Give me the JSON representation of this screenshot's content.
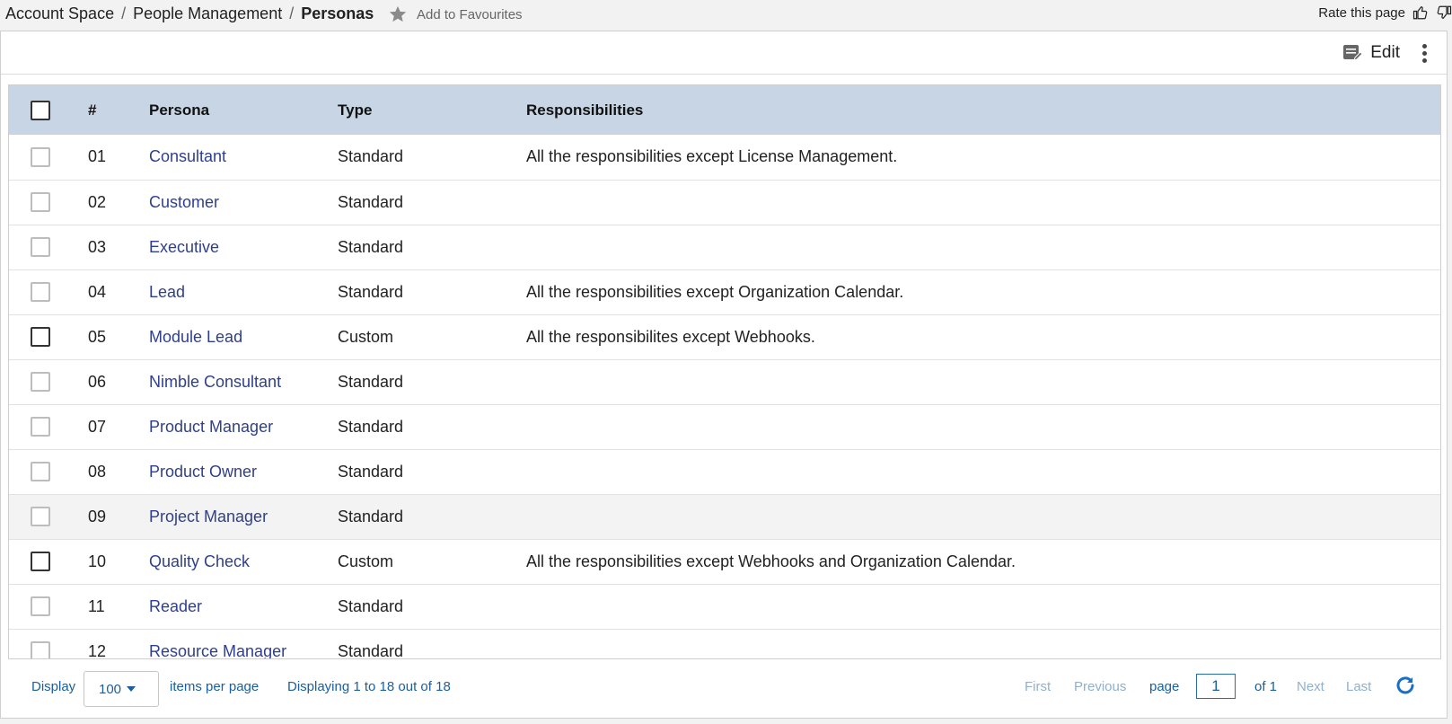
{
  "breadcrumb": {
    "items": [
      "Account Space",
      "People Management"
    ],
    "current": "Personas",
    "separator": "/"
  },
  "favourites_label": "Add to Favourites",
  "rate_label": "Rate this page",
  "toolbar": {
    "edit_label": "Edit"
  },
  "table": {
    "headers": {
      "num": "#",
      "persona": "Persona",
      "type": "Type",
      "responsibilities": "Responsibilities"
    },
    "rows": [
      {
        "num": "01",
        "persona": "Consultant",
        "type": "Standard",
        "responsibilities": "All the responsibilities except License Management."
      },
      {
        "num": "02",
        "persona": "Customer",
        "type": "Standard",
        "responsibilities": ""
      },
      {
        "num": "03",
        "persona": "Executive",
        "type": "Standard",
        "responsibilities": ""
      },
      {
        "num": "04",
        "persona": "Lead",
        "type": "Standard",
        "responsibilities": "All the responsibilities except Organization Calendar."
      },
      {
        "num": "05",
        "persona": "Module Lead",
        "type": "Custom",
        "responsibilities": "All the responsibilites except Webhooks."
      },
      {
        "num": "06",
        "persona": "Nimble Consultant",
        "type": "Standard",
        "responsibilities": ""
      },
      {
        "num": "07",
        "persona": "Product Manager",
        "type": "Standard",
        "responsibilities": ""
      },
      {
        "num": "08",
        "persona": "Product Owner",
        "type": "Standard",
        "responsibilities": ""
      },
      {
        "num": "09",
        "persona": "Project Manager",
        "type": "Standard",
        "responsibilities": ""
      },
      {
        "num": "10",
        "persona": "Quality Check",
        "type": "Custom",
        "responsibilities": "All the responsibilities except Webhooks and Organization Calendar."
      },
      {
        "num": "11",
        "persona": "Reader",
        "type": "Standard",
        "responsibilities": ""
      },
      {
        "num": "12",
        "persona": "Resource Manager",
        "type": "Standard",
        "responsibilities": ""
      }
    ]
  },
  "pager": {
    "display_label": "Display",
    "items_per_page_value": "100",
    "items_per_page_label": "items per page",
    "summary": "Displaying 1 to 18 out of 18",
    "first": "First",
    "previous": "Previous",
    "page_label": "page",
    "page_value": "1",
    "of_label": "of 1",
    "next": "Next",
    "last": "Last"
  },
  "colors": {
    "header_bg": "#c8d5e5",
    "link": "#2f3f8f",
    "pager_text": "#1a5fa0",
    "pager_disabled": "#8fb0cf"
  }
}
